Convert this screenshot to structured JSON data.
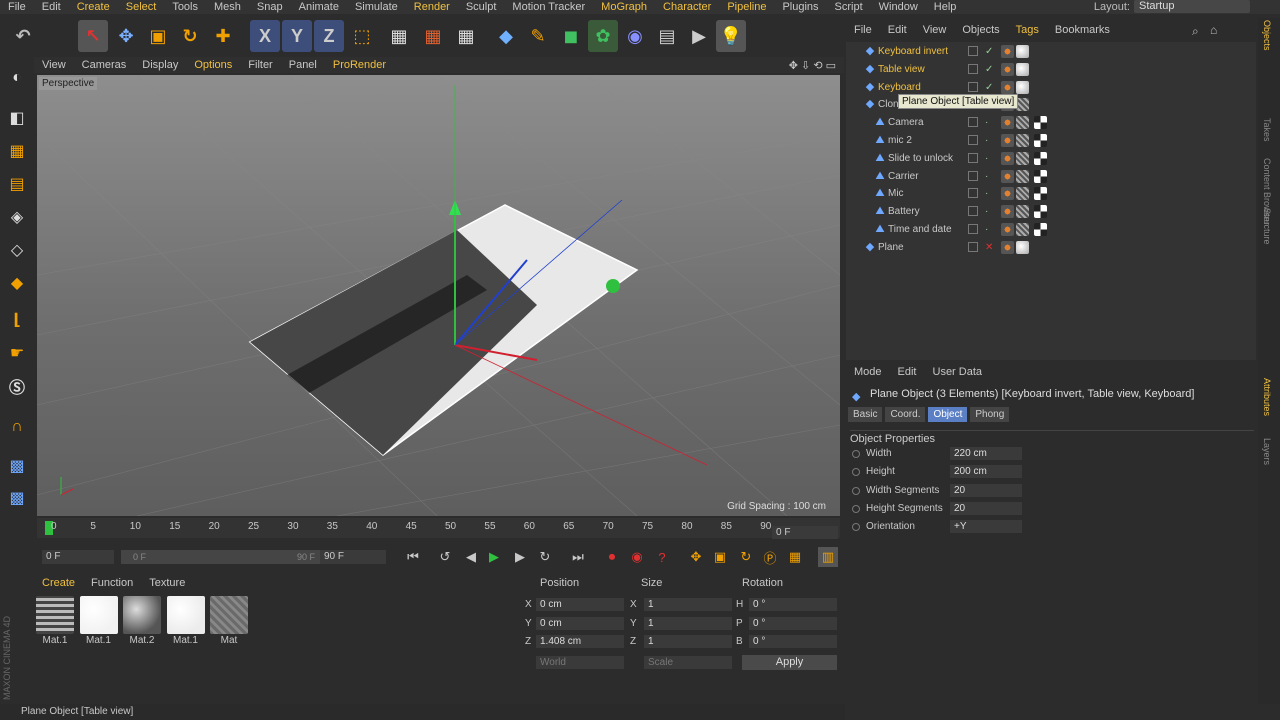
{
  "menubar": {
    "items": [
      "File",
      "Edit",
      "Create",
      "Select",
      "Tools",
      "Mesh",
      "Snap",
      "Animate",
      "Simulate",
      "Render",
      "Sculpt",
      "Motion Tracker",
      "MoGraph",
      "Character",
      "Pipeline",
      "Plugins",
      "Script",
      "Window",
      "Help"
    ],
    "highlighted": [
      "Create",
      "Select",
      "Render",
      "MoGraph",
      "Character",
      "Pipeline"
    ],
    "layout_label": "Layout:",
    "layout_value": "Startup"
  },
  "viewport": {
    "menu": [
      "View",
      "Cameras",
      "Display",
      "Options",
      "Filter",
      "Panel",
      "ProRender"
    ],
    "menu_highlight": [
      "Options",
      "ProRender"
    ],
    "label": "Perspective",
    "grid_spacing": "Grid Spacing : 100 cm"
  },
  "timeline": {
    "ticks": [
      "0",
      "5",
      "10",
      "15",
      "20",
      "25",
      "30",
      "35",
      "40",
      "45",
      "50",
      "55",
      "60",
      "65",
      "70",
      "75",
      "80",
      "85",
      "90"
    ],
    "current_frame": "0 F",
    "start_field": "0 F",
    "range_start": "0 F",
    "range_end": "90 F",
    "end_field": "90 F"
  },
  "materials": {
    "menu": [
      "Create",
      "Function",
      "Texture"
    ],
    "items": [
      {
        "label": "Mat.1",
        "color": "#9a9a9a"
      },
      {
        "label": "Mat.1",
        "color": "#f2f2f2"
      },
      {
        "label": "Mat.2",
        "color": "#8c8c8c"
      },
      {
        "label": "Mat.1",
        "color": "#ececec"
      },
      {
        "label": "Mat",
        "color": "#777777"
      }
    ]
  },
  "coordinates": {
    "headers": [
      "Position",
      "Size",
      "Rotation"
    ],
    "rows": [
      {
        "axis": "X",
        "pos": "0 cm",
        "size_axis": "X",
        "size": "1",
        "rot_axis": "H",
        "rot": "0 °"
      },
      {
        "axis": "Y",
        "pos": "0 cm",
        "size_axis": "Y",
        "size": "1",
        "rot_axis": "P",
        "rot": "0 °"
      },
      {
        "axis": "Z",
        "pos": "1.408 cm",
        "size_axis": "Z",
        "size": "1",
        "rot_axis": "B",
        "rot": "0 °"
      }
    ],
    "mode_left": "World",
    "mode_right": "Scale",
    "apply": "Apply"
  },
  "status": "Plane Object [Table view]",
  "brand": "MAXON CINEMA 4D",
  "object_manager": {
    "menu": [
      "File",
      "Edit",
      "View",
      "Objects",
      "Tags",
      "Bookmarks"
    ],
    "menu_highlight": [
      "Tags"
    ],
    "rows": [
      {
        "name": "Keyboard invert",
        "indent": 0,
        "color": "#f0c040",
        "check": true
      },
      {
        "name": "Table view",
        "indent": 0,
        "color": "#f0c040",
        "check": true
      },
      {
        "name": "Keyboard",
        "indent": 0,
        "color": "#f0c040",
        "check": true
      },
      {
        "name": "Clon",
        "indent": 0,
        "color": "#c8c8c8",
        "check": false
      },
      {
        "name": "Camera",
        "indent": 1,
        "color": "#c8c8c8",
        "check": false
      },
      {
        "name": "mic 2",
        "indent": 1,
        "color": "#c8c8c8",
        "check": false
      },
      {
        "name": "Slide to unlock",
        "indent": 1,
        "color": "#c8c8c8",
        "check": false
      },
      {
        "name": "Carrier",
        "indent": 1,
        "color": "#c8c8c8",
        "check": false
      },
      {
        "name": "Mic",
        "indent": 1,
        "color": "#c8c8c8",
        "check": false
      },
      {
        "name": "Battery",
        "indent": 1,
        "color": "#c8c8c8",
        "check": false
      },
      {
        "name": "Time and date",
        "indent": 1,
        "color": "#c8c8c8",
        "check": false
      },
      {
        "name": "Plane",
        "indent": 0,
        "color": "#c8c8c8",
        "check": false
      }
    ],
    "tooltip": "Plane Object [Table view]"
  },
  "attributes": {
    "menu": [
      "Mode",
      "Edit",
      "User Data"
    ],
    "title": "Plane Object (3 Elements) [Keyboard invert, Table view, Keyboard]",
    "tabs": [
      "Basic",
      "Coord.",
      "Object",
      "Phong"
    ],
    "active_tab": "Object",
    "section": "Object Properties",
    "props": [
      {
        "label": "Width",
        "value": "220 cm"
      },
      {
        "label": "Height",
        "value": "200 cm"
      },
      {
        "label": "Width Segments",
        "value": "20"
      },
      {
        "label": "Height Segments",
        "value": "20"
      },
      {
        "label": "Orientation",
        "value": "+Y"
      }
    ]
  },
  "right_tabs": [
    "Objects",
    "Takes",
    "Content Browser",
    "Structure",
    "Attributes",
    "Layers"
  ]
}
